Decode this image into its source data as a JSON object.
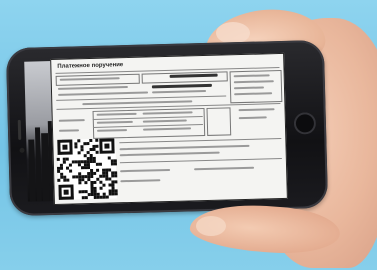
{
  "scene": {
    "description_colors": {
      "sky": "#7dcae9",
      "skin": "#e9b79c",
      "phone_body": "#111114",
      "screen_paper": "#f4f4f2"
    }
  },
  "document": {
    "title": "Платежное поручение"
  }
}
